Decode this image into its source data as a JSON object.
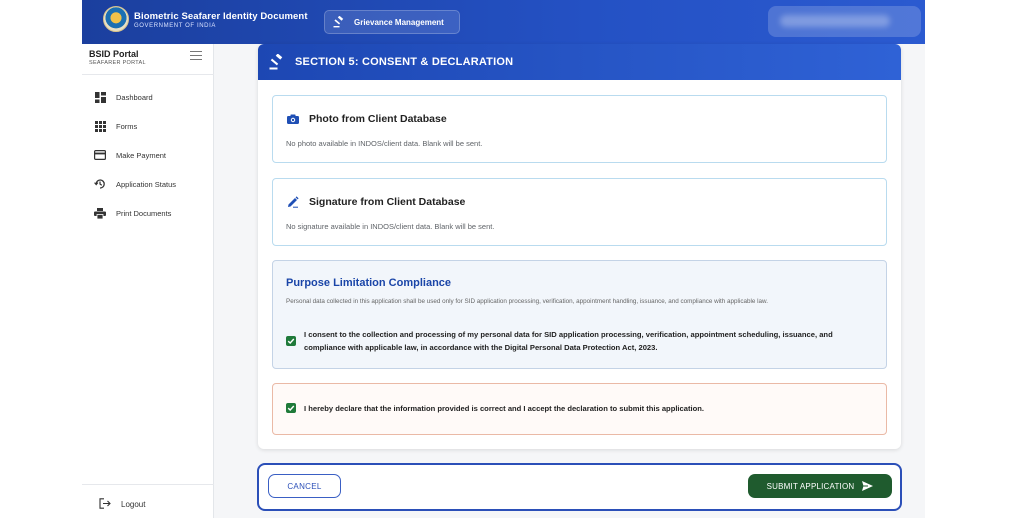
{
  "header": {
    "brand_title": "Biometric Seafarer Identity Document",
    "brand_subtitle": "GOVERNMENT OF INDIA",
    "grievance_label": "Grievance Management"
  },
  "sidebar": {
    "portal_title": "BSID Portal",
    "portal_subtitle": "SEAFARER PORTAL",
    "items": [
      {
        "label": "Dashboard",
        "icon": "dashboard-icon"
      },
      {
        "label": "Forms",
        "icon": "grid-icon"
      },
      {
        "label": "Make Payment",
        "icon": "credit-card-icon"
      },
      {
        "label": "Application Status",
        "icon": "history-icon"
      },
      {
        "label": "Print Documents",
        "icon": "printer-icon"
      }
    ],
    "logout_label": "Logout"
  },
  "section": {
    "title": "SECTION 5: CONSENT & DECLARATION"
  },
  "photo_panel": {
    "title": "Photo from Client Database",
    "text": "No photo available in INDOS/client data. Blank will be sent."
  },
  "signature_panel": {
    "title": "Signature from Client Database",
    "text": "No signature available in INDOS/client data. Blank will be sent."
  },
  "purpose_panel": {
    "title": "Purpose Limitation Compliance",
    "body": "Personal data collected in this application shall be used only for SID application processing, verification, appointment handling, issuance, and compliance with applicable law.",
    "consent_text": "I consent to the collection and processing of my personal data for SID application processing, verification, appointment scheduling, issuance, and compliance with applicable law, in accordance with the Digital Personal Data Protection Act, 2023.",
    "consent_checked": true
  },
  "declaration_panel": {
    "text": "I hereby declare that the information provided is correct and I accept the declaration to submit this application.",
    "checked": true
  },
  "actions": {
    "cancel_label": "CANCEL",
    "submit_label": "SUBMIT APPLICATION"
  },
  "colors": {
    "header_blue": "#1b3f9e",
    "accent_blue": "#1a45a8",
    "success_green": "#1f5b2e",
    "checkbox_green": "#1f7a3a"
  }
}
